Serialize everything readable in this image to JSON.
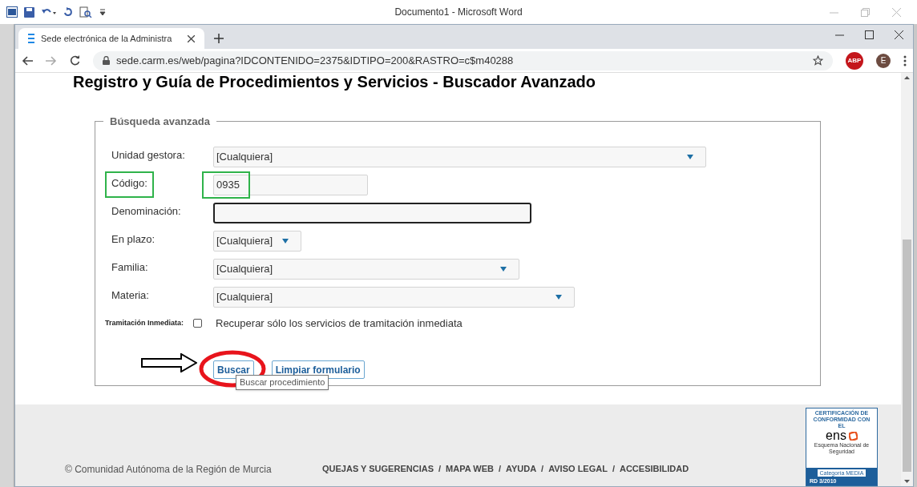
{
  "word_window": {
    "title": "Documento1  -  Microsoft Word"
  },
  "browser": {
    "tab_title": "Sede electrónica de la Administra",
    "url": "sede.carm.es/web/pagina?IDCONTENIDO=2375&IDTIPO=200&RASTRO=c$m40288",
    "profile_initial": "E",
    "extension_label": "ABP"
  },
  "page": {
    "heading": "Registro y Guía de Procedimientos y Servicios - Buscador Avanzado",
    "form": {
      "legend": "Búsqueda avanzada",
      "fields": [
        {
          "kind": "select",
          "label": "Unidad gestora:",
          "value": "[Cualquiera]",
          "focused": false,
          "highlighted": false
        },
        {
          "kind": "text",
          "label": "Código:",
          "value": "0935",
          "focused": false,
          "highlighted": true
        },
        {
          "kind": "text",
          "label": "Denominación:",
          "focused": true,
          "highlighted": false
        },
        {
          "kind": "select",
          "label": "En plazo:",
          "value": "[Cualquiera]",
          "focused": false,
          "highlighted": false
        },
        {
          "kind": "select",
          "label": "Familia:",
          "value": "[Cualquiera]",
          "focused": false,
          "highlighted": false
        },
        {
          "kind": "select",
          "label": "Materia:",
          "value": "[Cualquiera]",
          "focused": false,
          "highlighted": false
        }
      ],
      "checkbox": {
        "label": "Tramitación Inmediata:",
        "text": "Recuperar sólo los servicios de tramitación inmediata",
        "checked": false
      },
      "buttons": [
        {
          "label": "Buscar",
          "circled": true
        },
        {
          "label": "Limpiar formulario",
          "circled": false
        }
      ],
      "tooltip": "Buscar procedimiento"
    },
    "footer": {
      "copyright": "© Comunidad Autónoma de la Región de Murcia",
      "links": [
        "QUEJAS Y SUGERENCIAS",
        "MAPA WEB",
        "AYUDA",
        "AVISO LEGAL",
        "ACCESIBILIDAD"
      ],
      "separator": "/",
      "badge": {
        "heading": "CERTIFICACIÓN DE CONFORMIDAD CON EL",
        "logo": "ens",
        "logo_caption": "Esquema Nacional de Seguridad",
        "category_label": "Categoría",
        "category": "MEDIA",
        "decree": "RD 3/2010"
      }
    }
  }
}
